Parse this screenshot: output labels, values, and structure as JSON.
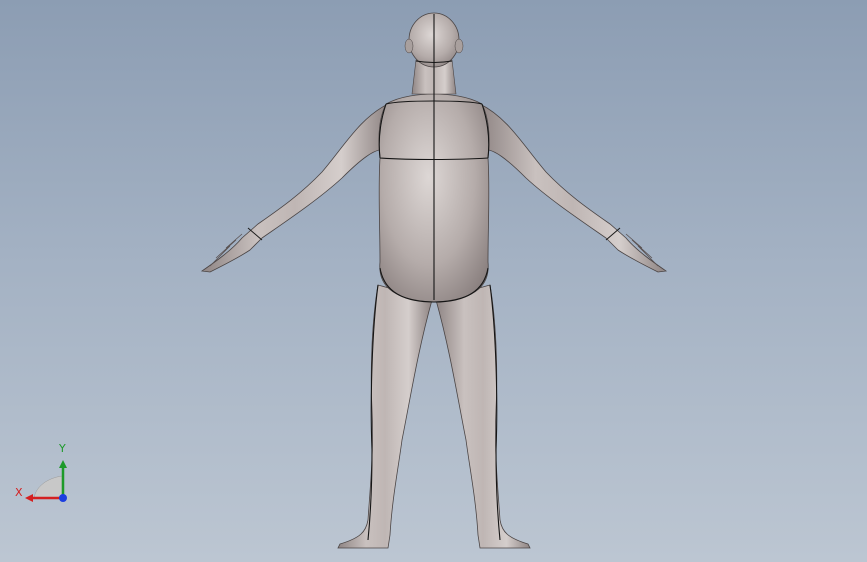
{
  "triad": {
    "x_label": "X",
    "y_label": "Y",
    "x_color": "#d42020",
    "y_color": "#1d9a2a",
    "z_color": "#1b3ee0"
  },
  "model": {
    "surface_color": "#b3aaa8",
    "edge_color": "#1a1a1a"
  },
  "background": {
    "top_color": "#8c9db3",
    "bottom_color": "#bcc6d2"
  }
}
